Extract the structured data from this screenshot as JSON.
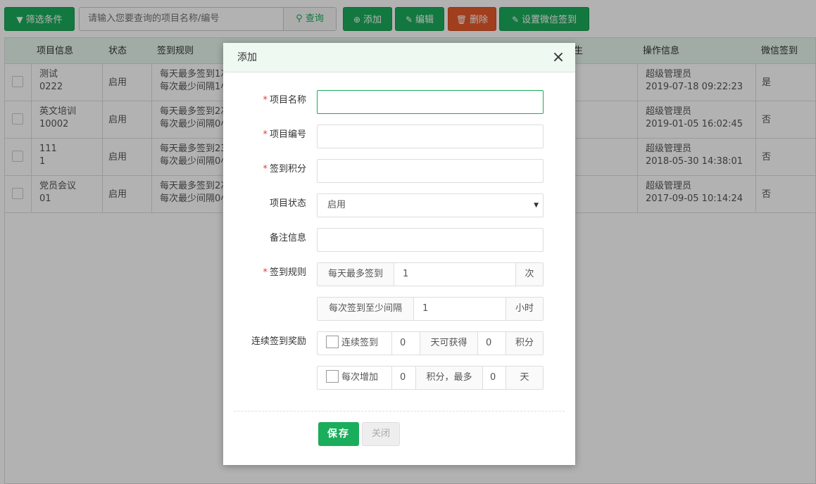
{
  "toolbar": {
    "filter_label": "筛选条件",
    "search_placeholder": "请输入您要查询的项目名称/编号",
    "search_label": "查询",
    "add_label": "添加",
    "edit_label": "编辑",
    "delete_label": "删除",
    "wechat_label": "设置微信签到"
  },
  "table": {
    "headers": {
      "info": "项目信息",
      "status": "状态",
      "rule": "签到规则",
      "partial": "生",
      "op": "操作信息",
      "wechat": "微信签到"
    },
    "rows": [
      {
        "name": "测试",
        "code": "0222",
        "status": "启用",
        "rule1": "每天最多签到1次",
        "rule2": "每次最少间隔1小时",
        "op_user": "超级管理员",
        "op_time": "2019-07-18 09:22:23",
        "wechat": "是"
      },
      {
        "name": "英文培训",
        "code": "10002",
        "status": "启用",
        "rule1": "每天最多签到2次",
        "rule2": "每次最少间隔0小时",
        "op_user": "超级管理员",
        "op_time": "2019-01-05 16:02:45",
        "wechat": "否"
      },
      {
        "name": "111",
        "code": "1",
        "status": "启用",
        "rule1": "每天最多签到23次",
        "rule2": "每次最少间隔0小时",
        "op_user": "超级管理员",
        "op_time": "2018-05-30 14:38:01",
        "wechat": "否"
      },
      {
        "name": "党员会议",
        "code": "01",
        "status": "启用",
        "rule1": "每天最多签到2次",
        "rule2": "每次最少间隔0小时",
        "op_user": "超级管理员",
        "op_time": "2017-09-05 10:14:24",
        "wechat": "否"
      }
    ]
  },
  "modal": {
    "title": "添加",
    "close_icon": "×",
    "required_mark": "*",
    "labels": {
      "name": "项目名称",
      "code": "项目编号",
      "points": "签到积分",
      "status": "项目状态",
      "remark": "备注信息",
      "rule": "签到规则",
      "reward": "连续签到奖励"
    },
    "status_value": "启用",
    "rule": {
      "daily_prefix": "每天最多签到",
      "daily_value": "1",
      "daily_suffix": "次",
      "interval_prefix": "每次签到至少间隔",
      "interval_value": "1",
      "interval_suffix": "小时"
    },
    "reward": {
      "consecutive_label": "连续签到",
      "consecutive_days": "0",
      "consecutive_mid": "天可获得",
      "consecutive_points": "0",
      "consecutive_suffix": "积分",
      "increment_label": "每次增加",
      "increment_points": "0",
      "increment_mid": "积分，最多",
      "increment_days": "0",
      "increment_suffix": "天"
    },
    "save_label": "保存",
    "close_label": "关闭"
  },
  "colors": {
    "accent": "#1aad5b",
    "danger": "#e65a2b",
    "header_bg": "#e5f6ec"
  }
}
